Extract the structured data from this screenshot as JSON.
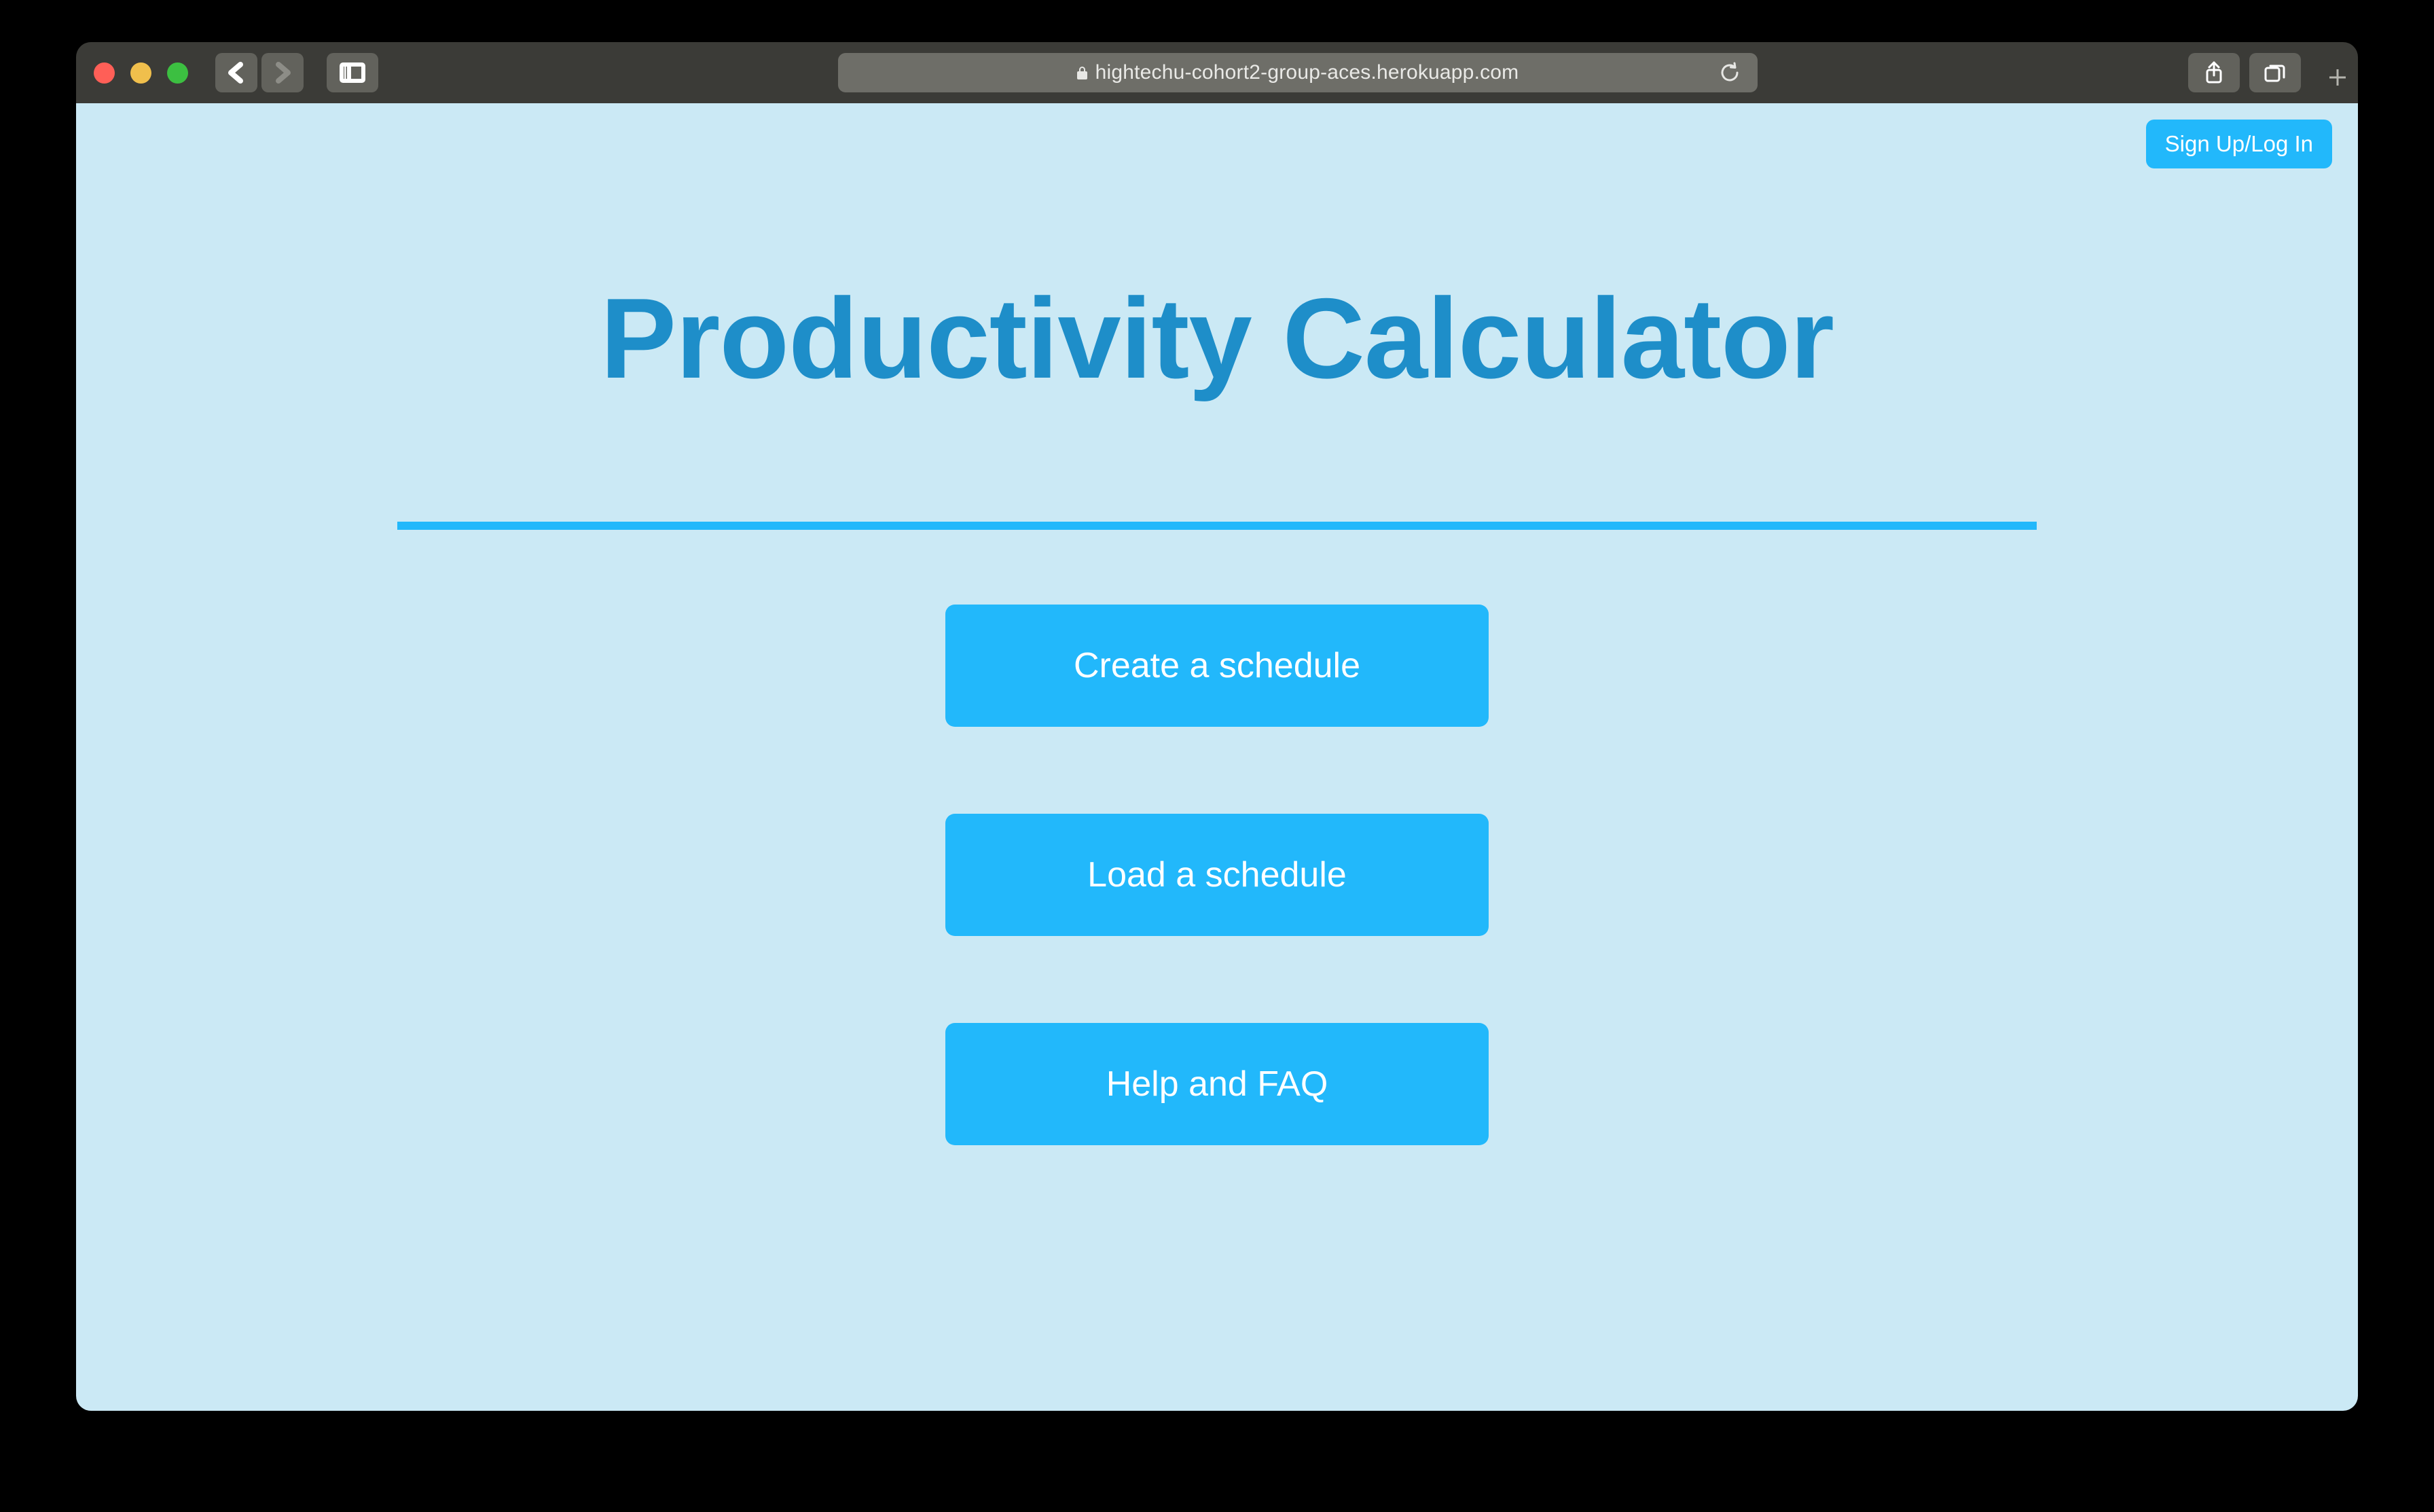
{
  "browser": {
    "traffic_lights": [
      "close",
      "minimize",
      "maximize"
    ],
    "back_label": "Back",
    "forward_label": "Forward",
    "sidebar_label": "Show Sidebar",
    "url": "hightechu-cohort2-group-aces.herokuapp.com",
    "secure_icon": "lock-icon",
    "reload_label": "Reload",
    "share_label": "Share",
    "tabs_label": "Show Tab Overview",
    "new_tab_label": "+"
  },
  "page": {
    "title": "Productivity Calculator",
    "signup_label": "Sign Up/Log In",
    "buttons": [
      {
        "label": "Create a schedule"
      },
      {
        "label": "Load a schedule"
      },
      {
        "label": "Help and FAQ"
      }
    ]
  },
  "colors": {
    "accent": "#22b8fb",
    "title": "#1e8ec9",
    "page_background": "#cbe9f5",
    "toolbar": "#3b3b37"
  }
}
